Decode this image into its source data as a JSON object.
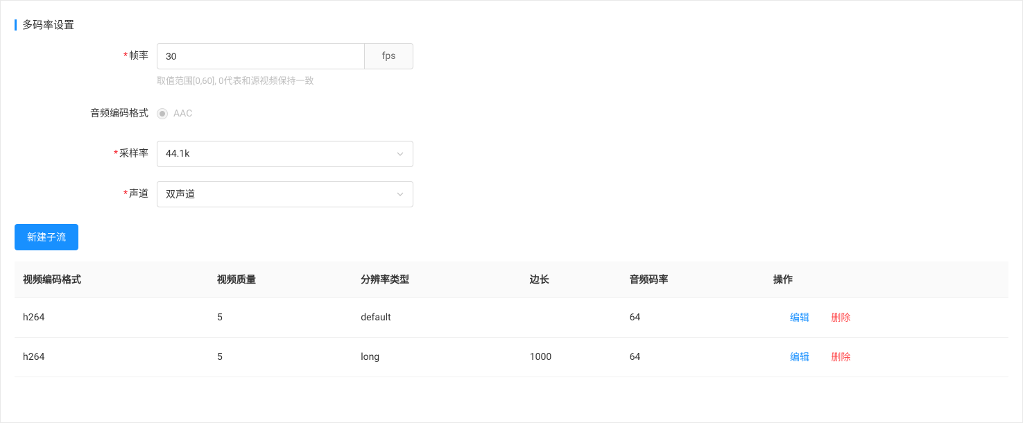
{
  "section": {
    "title": "多码率设置"
  },
  "form": {
    "fps": {
      "label": "帧率",
      "value": "30",
      "unit": "fps",
      "hint": "取值范围[0,60], 0代表和源视频保持一致",
      "required": true
    },
    "audio_codec": {
      "label": "音频编码格式",
      "value": "AAC",
      "required": false
    },
    "sample_rate": {
      "label": "采样率",
      "value": "44.1k",
      "required": true
    },
    "channel": {
      "label": "声道",
      "value": "双声道",
      "required": true
    }
  },
  "buttons": {
    "new_stream": "新建子流"
  },
  "table": {
    "headers": [
      "视频编码格式",
      "视频质量",
      "分辨率类型",
      "边长",
      "音频码率",
      "操作"
    ],
    "rows": [
      {
        "codec": "h264",
        "quality": "5",
        "res_type": "default",
        "edge": "",
        "audio_bitrate": "64"
      },
      {
        "codec": "h264",
        "quality": "5",
        "res_type": "long",
        "edge": "1000",
        "audio_bitrate": "64"
      }
    ],
    "actions": {
      "edit": "编辑",
      "delete": "删除"
    }
  }
}
